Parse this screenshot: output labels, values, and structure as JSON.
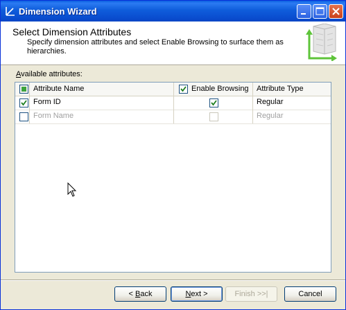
{
  "window": {
    "title": "Dimension Wizard"
  },
  "header": {
    "title": "Select Dimension Attributes",
    "description": "Specify dimension attributes and select Enable Browsing to surface them as hierarchies."
  },
  "attributes": {
    "label_accel": "A",
    "label_rest": "vailable attributes:",
    "columns": {
      "name": "Attribute Name",
      "browsing": "Enable Browsing",
      "type": "Attribute Type"
    },
    "rows": [
      {
        "name": "Form ID",
        "type": "Regular",
        "selected": true,
        "browsing": true,
        "enabled": true
      },
      {
        "name": "Form Name",
        "type": "Regular",
        "selected": false,
        "browsing": false,
        "enabled": false
      }
    ]
  },
  "buttons": {
    "back": {
      "accel": "B",
      "rest": "ack",
      "prefix": "< "
    },
    "next": {
      "accel": "N",
      "rest": "ext >"
    },
    "finish": "Finish >>|",
    "cancel": "Cancel"
  },
  "colors": {
    "titlebar": "#0A5FE0",
    "checkmark": "#1E7E1E",
    "border": "#7F9DB9"
  }
}
